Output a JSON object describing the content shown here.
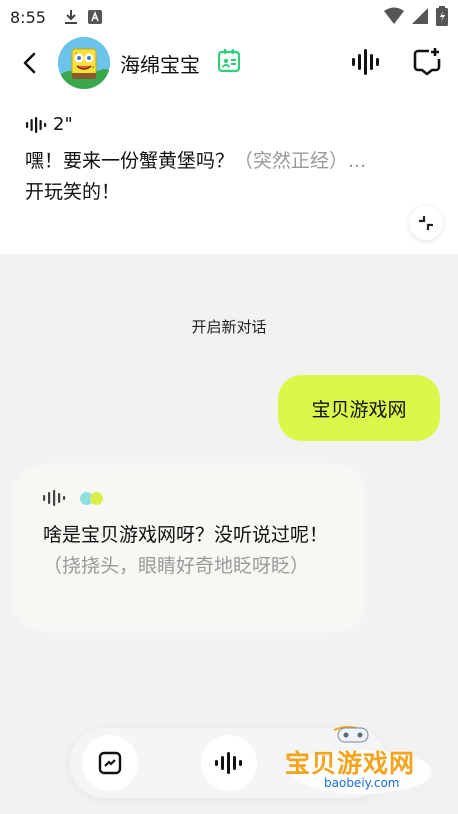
{
  "status_bar": {
    "time": "8:55"
  },
  "header": {
    "title": "海绵宝宝"
  },
  "summary": {
    "voice_duration": "2\"",
    "text_main": "嘿！要来一份蟹黄堡吗？",
    "text_hint": "（突然正经）...",
    "text_line2": "开玩笑的！"
  },
  "chat": {
    "divider": "开启新对话",
    "user_message": "宝贝游戏网",
    "ai_reply": {
      "text": "啥是宝贝游戏网呀？没听说过呢！",
      "hint": "（挠挠头，眼睛好奇地眨呀眨）"
    }
  },
  "watermark": {
    "title": "宝贝游戏网",
    "url": "baobeiy.com"
  },
  "colors": {
    "accent": "#dcf64a",
    "dot_left": "#8ee0e0",
    "dot_right": "#d8ef4a",
    "badge": "#2ecf7a"
  },
  "icons": [
    "download-icon",
    "a-icon",
    "wifi-icon",
    "signal-icon",
    "battery-icon",
    "back-icon",
    "id-badge-icon",
    "voice-wave-icon",
    "new-chat-icon",
    "collapse-icon",
    "keyboard-icon",
    "mic-wave-icon"
  ]
}
